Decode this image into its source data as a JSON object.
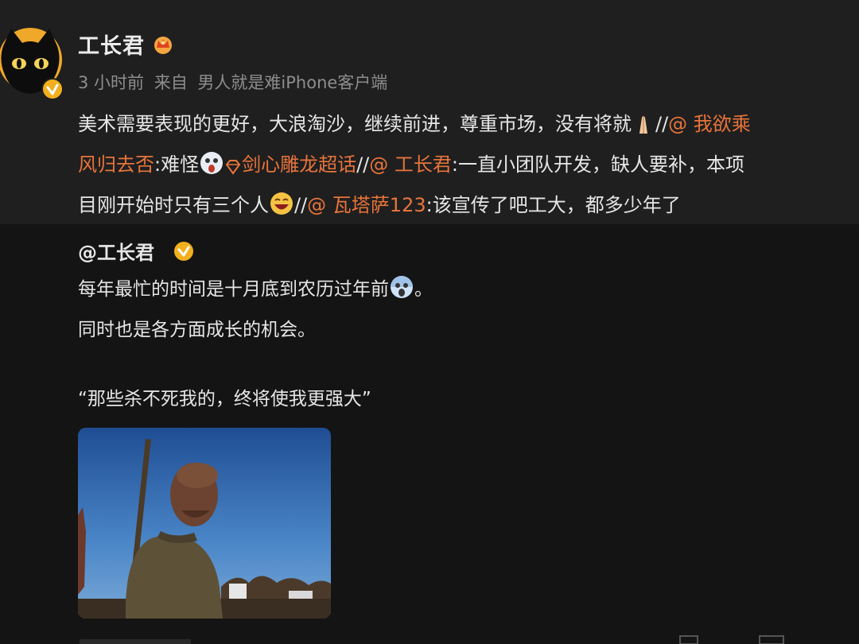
{
  "post": {
    "username": "工长君",
    "time": "3 小时前",
    "source_prefix": "来自",
    "source": "男人就是难iPhone客户端",
    "line1_text": "美术需要表现的更好，大浪淘沙，继续前进，尊重市场，没有将就",
    "line1_sep": "//",
    "line1_mention": "@ 我欲乘",
    "line2_mention": "风归去否",
    "line2_text1": ":难怪",
    "line2_topic": "剑心雕龙超话",
    "line2_sep": "//",
    "line2_mention2": "@ 工长君",
    "line2_text2": ":一直小团队开发，缺人要补，本项",
    "line3_text1": "目刚开始时只有三个人",
    "line3_sep": "//",
    "line3_mention": "@ 瓦塔萨123",
    "line3_text2": ":该宣传了吧工大，都多少年了"
  },
  "repost": {
    "author": "@工长君",
    "line1": "每年最忙的时间是十月底到农历过年前",
    "line1_end": "。",
    "line2": "同时也是各方面成长的机会。",
    "quote": "“那些杀不死我的，终将使我更强大”"
  },
  "icons": {
    "avatar": "black-cat-avatar",
    "verified": "verified-badge-icon",
    "crown": "crown-icon",
    "pray": "praying-hands-emoji",
    "scared": "scared-face-emoji",
    "laugh": "laughing-face-emoji",
    "scream": "screaming-face-emoji",
    "topic": "diamond-topic-icon"
  },
  "colors": {
    "mention": "#e8743b",
    "verified": "#f2b01e",
    "post_bg": "#1f1f1f",
    "page_bg": "#141414"
  }
}
